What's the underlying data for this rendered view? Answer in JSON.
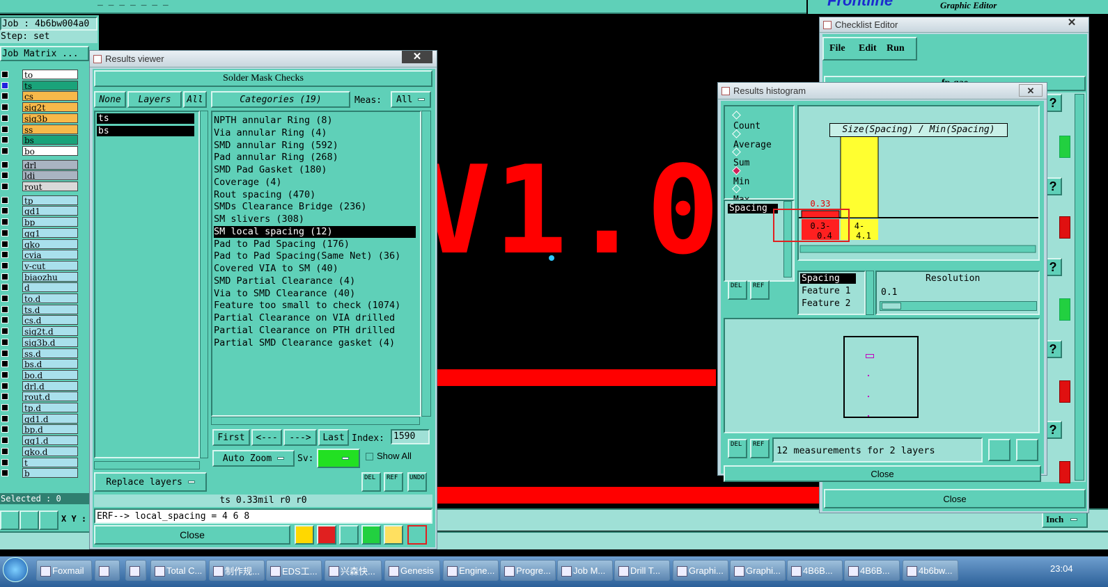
{
  "top": {
    "logo": "Frontline",
    "app_subtitle": "Graphic Editor",
    "menu_text": "_  _  _  _  _  _  _"
  },
  "left": {
    "job": "Job : 4b6bw004a0",
    "step": "Step: set",
    "job_matrix": "Job Matrix ...",
    "layers": [
      {
        "name": "to",
        "color": "#ffffff"
      },
      {
        "name": "ts",
        "color": "#1aa37a"
      },
      {
        "name": "cs",
        "color": "#f7b94a"
      },
      {
        "name": "sig2t",
        "color": "#f7b94a"
      },
      {
        "name": "sig3b",
        "color": "#f7b94a"
      },
      {
        "name": "ss",
        "color": "#f7b94a"
      },
      {
        "name": "bs",
        "color": "#1aa37a"
      },
      {
        "name": "bo",
        "color": "#ffffff"
      },
      {
        "name": "drl",
        "color": "#a9b4c2"
      },
      {
        "name": "ldi",
        "color": "#a9b4c2"
      },
      {
        "name": "rout",
        "color": "#d9d9d9"
      },
      {
        "name": "tp",
        "color": "#a9e0ec"
      },
      {
        "name": "gd1",
        "color": "#a9e0ec"
      },
      {
        "name": "bp",
        "color": "#a9e0ec"
      },
      {
        "name": "gg1",
        "color": "#a9e0ec"
      },
      {
        "name": "gko",
        "color": "#a9e0ec"
      },
      {
        "name": "cvia",
        "color": "#a9e0ec"
      },
      {
        "name": "v-cut",
        "color": "#a9e0ec"
      },
      {
        "name": "biaozhu",
        "color": "#a9e0ec"
      },
      {
        "name": "d",
        "color": "#a9e0ec"
      },
      {
        "name": "to.d",
        "color": "#a9e0ec"
      },
      {
        "name": "ts.d",
        "color": "#a9e0ec"
      },
      {
        "name": "cs.d",
        "color": "#a9e0ec"
      },
      {
        "name": "sig2t.d",
        "color": "#a9e0ec"
      },
      {
        "name": "sig3b.d",
        "color": "#a9e0ec"
      },
      {
        "name": "ss.d",
        "color": "#a9e0ec"
      },
      {
        "name": "bs.d",
        "color": "#a9e0ec"
      },
      {
        "name": "bo.d",
        "color": "#a9e0ec"
      },
      {
        "name": "drl.d",
        "color": "#a9e0ec"
      },
      {
        "name": "rout.d",
        "color": "#a9e0ec"
      },
      {
        "name": "tp.d",
        "color": "#a9e0ec"
      },
      {
        "name": "gd1.d",
        "color": "#a9e0ec"
      },
      {
        "name": "bp.d",
        "color": "#a9e0ec"
      },
      {
        "name": "gg1.d",
        "color": "#a9e0ec"
      },
      {
        "name": "gko.d",
        "color": "#a9e0ec"
      },
      {
        "name": "t",
        "color": "#a9e0ec"
      },
      {
        "name": "b",
        "color": "#a9e0ec"
      }
    ],
    "selected": "Selected : 0",
    "xy": "X Y :"
  },
  "canvas": {
    "text": "V1.0"
  },
  "results_viewer": {
    "title": "Results viewer",
    "heading": "Solder Mask Checks",
    "none": "None",
    "layers": "Layers",
    "all": "All",
    "categories": "Categories (19)",
    "meas_label": "Meas:",
    "meas_value": "All",
    "layer_items": [
      "ts",
      "bs"
    ],
    "category_items": [
      "NPTH annular Ring (8)",
      "Via annular Ring (4)",
      "SMD annular Ring (592)",
      "Pad annular Ring (268)",
      "SMD Pad Gasket (180)",
      "Coverage (4)",
      "Rout spacing (470)",
      "SMDs Clearance Bridge (236)",
      "SM slivers (308)",
      "SM local spacing (12)",
      "Pad to Pad Spacing (176)",
      "Pad to Pad Spacing(Same Net) (36)",
      "Covered VIA to SM (40)",
      "SMD Partial Clearance (4)",
      "Via to SMD Clearance (40)",
      "Feature too small to check (1074)",
      "Partial Clearance on VIA drilled",
      "Partial Clearance on PTH drilled",
      "Partial SMD Clearance gasket (4)"
    ],
    "first": "First",
    "prev": "<---",
    "next": "--->",
    "last": "Last",
    "index_label": "Index:",
    "index_value": "1590",
    "auto_zoom": "Auto Zoom",
    "sv": "Sv:",
    "show_all": "Show All",
    "replace_layers": "Replace layers",
    "del": "DEL",
    "ref": "REF",
    "undo": "UNDO",
    "status": "ts 0.33mil  r0  r0",
    "erf": "ERF--> local_spacing = 4 6 8",
    "close": "Close"
  },
  "histogram": {
    "title": "Results histogram",
    "radios": [
      "Count",
      "Average",
      "Sum",
      "Min",
      "Max"
    ],
    "selected_radio": "Min",
    "chart_title": "Size(Spacing) / Min(Spacing)",
    "list_item": "Spacing",
    "fields": [
      "Spacing",
      "Feature 1",
      "Feature 2"
    ],
    "resolution_label": "Resolution",
    "resolution_value": "0.1",
    "measurements": "12 measurements for 2 layers",
    "close": "Close",
    "del": "DEL",
    "ref": "REF"
  },
  "chart_data": {
    "type": "bar",
    "title": "Size(Spacing) / Min(Spacing)",
    "categories": [
      "0.3-0.4",
      "4-4.1"
    ],
    "values": [
      0.33,
      4
    ],
    "value_labels": [
      "0.33",
      "4"
    ],
    "bar_colors": [
      "#ff2020",
      "#ffff30"
    ]
  },
  "checklist": {
    "title": "Checklist Editor",
    "menu": [
      "File",
      "Edit",
      "Run"
    ],
    "name": "fp-qae",
    "q": "?",
    "close": "Close"
  },
  "units": "Inch",
  "taskbar": {
    "items": [
      "Foxmail",
      "",
      "",
      "Total C...",
      "制作规...",
      "EDS工...",
      "兴森快...",
      "Genesis",
      "Engine...",
      "Progre...",
      "Job M...",
      "Drill T...",
      "Graphi...",
      "Graphi...",
      "4B6B...",
      "4B6B...",
      "4b6bw..."
    ],
    "time": "23:04"
  }
}
